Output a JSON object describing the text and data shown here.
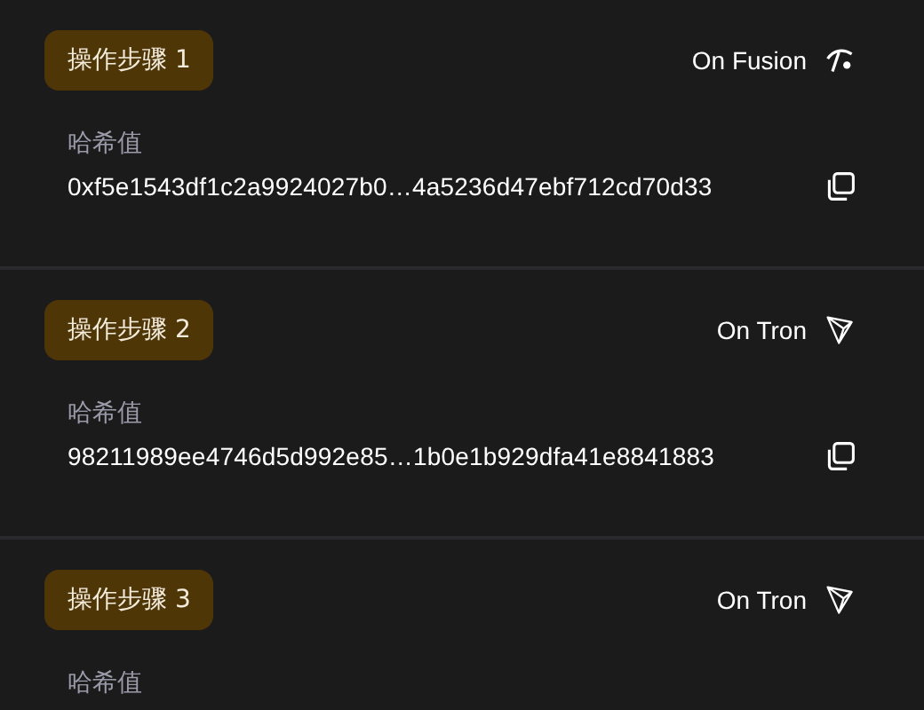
{
  "steps": [
    {
      "badge": "操作步骤 1",
      "network": "On Fusion",
      "kind": "fusion",
      "hash_label": "哈希值",
      "hash": "0xf5e1543df1c2a9924027b0…4a5236d47ebf712cd70d33"
    },
    {
      "badge": "操作步骤 2",
      "network": "On Tron",
      "kind": "tron",
      "hash_label": "哈希值",
      "hash": "98211989ee4746d5d992e85…1b0e1b929dfa41e8841883"
    },
    {
      "badge": "操作步骤 3",
      "network": "On Tron",
      "kind": "tron",
      "hash_label": "哈希值"
    }
  ]
}
